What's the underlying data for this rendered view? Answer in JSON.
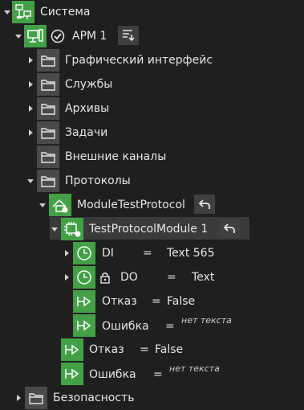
{
  "tree": {
    "system": "Система",
    "arm": "АРМ 1",
    "gui": "Графический интерфейс",
    "services": "Службы",
    "archives": "Архивы",
    "tasks": "Задачи",
    "external": "Внешние каналы",
    "protocols": "Протоколы",
    "module_protocol": "ModuleTestProtocol",
    "module": "TestProtocolModule 1",
    "di": {
      "name": "DI",
      "eq": "=",
      "value": "Text 565"
    },
    "do": {
      "name": "DO",
      "eq": "=",
      "value": "Text"
    },
    "otkaz_inner": {
      "name": "Отказ",
      "eq": "=",
      "value": "False"
    },
    "oshibka_inner": {
      "name": "Ошибка",
      "eq": "=",
      "value": "нет текста"
    },
    "otkaz_outer": {
      "name": "Отказ",
      "eq": "=",
      "value": "False"
    },
    "oshibka_outer": {
      "name": "Ошибка",
      "eq": "=",
      "value": "нет текста"
    },
    "security": "Безопасность"
  },
  "colors": {
    "accent_green": "#43a047",
    "folder_grey": "#4a4a4a",
    "selected_row": "#3a3a3a"
  },
  "icons": {
    "system": "network-computers-icon",
    "arm": "computer-icon",
    "folder": "folder-icon",
    "protocol": "module-protocol-icon",
    "module": "chip-icon",
    "clock": "clock-icon",
    "lock": "lock-icon",
    "signal": "signal-arrow-icon",
    "back": "back-arrow-icon",
    "apply": "apply-settings-icon",
    "check": "check-circle-icon"
  }
}
